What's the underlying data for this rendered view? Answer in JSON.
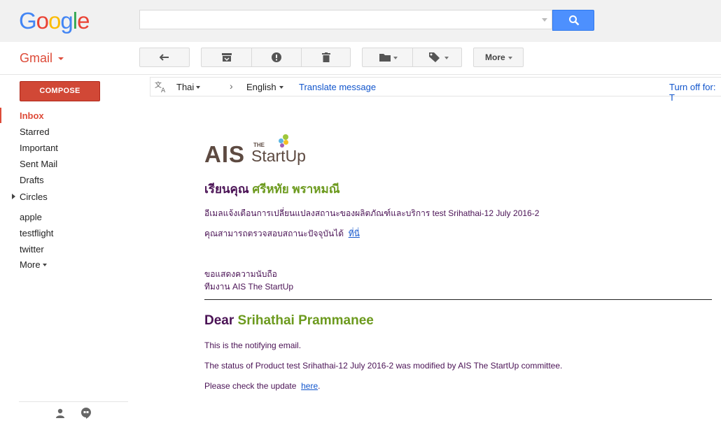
{
  "brand": {
    "logo_letters": [
      "G",
      "o",
      "o",
      "g",
      "l",
      "e"
    ],
    "logo_colors": [
      "#4285f4",
      "#ea4335",
      "#fbbc05",
      "#4285f4",
      "#34a853",
      "#ea4335"
    ]
  },
  "header": {
    "search_value": "",
    "app_name": "Gmail"
  },
  "toolbar": {
    "more_label": "More"
  },
  "sidebar": {
    "compose_label": "COMPOSE",
    "items": [
      {
        "label": "Inbox"
      },
      {
        "label": "Starred"
      },
      {
        "label": "Important"
      },
      {
        "label": "Sent Mail"
      },
      {
        "label": "Drafts"
      },
      {
        "label": "Circles"
      },
      {
        "label": "apple"
      },
      {
        "label": "testflight"
      },
      {
        "label": "twitter"
      },
      {
        "label": "More"
      }
    ]
  },
  "translate": {
    "from_lang": "Thai",
    "to_lang": "English",
    "translate_link": "Translate message",
    "turn_off": "Turn off for: T"
  },
  "email": {
    "logo_main": "AIS",
    "logo_the": "THE",
    "logo_startup": "StartUp",
    "thai_greeting": "เรียนคุณ",
    "thai_name": "ศรีหทัย พราหมณี",
    "thai_line1": "อีเมลแจ้งเตือนการเปลี่ยนแปลงสถานะของผลิตภัณฑ์และบริการ test Srihathai-12 July 2016-2",
    "thai_line2": "คุณสามารถตรวจสอบสถานะปัจจุบันได้",
    "thai_link": "ที่นี่",
    "thai_regards": "ขอแสดงความนับถือ",
    "thai_team": "ทีมงาน AIS The StartUp",
    "en_greeting": "Dear",
    "en_name": "Srihathai Prammanee",
    "en_line1": "This is the notifying email.",
    "en_line2": "The status of Product test Srihathai-12 July 2016-2 was modified by AIS The StartUp committee.",
    "en_line3": "Please check the update",
    "en_link": "here",
    "en_after_link": "."
  }
}
